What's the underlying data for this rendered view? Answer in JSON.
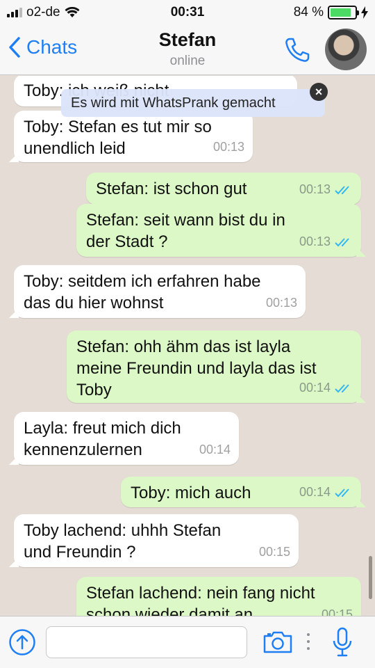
{
  "status_bar": {
    "carrier": "o2-de",
    "time": "00:31",
    "battery_percent": "84 %",
    "battery_level": 0.84,
    "icons": [
      "signal-icon",
      "wifi-icon",
      "battery-icon",
      "charging-icon"
    ]
  },
  "header": {
    "back_label": "Chats",
    "contact_name": "Stefan",
    "contact_status": "online",
    "icons": [
      "chevron-left-icon",
      "phone-icon",
      "avatar"
    ]
  },
  "banner": {
    "text": "Es wird mit WhatsPrank gemacht",
    "close_label": "×"
  },
  "messages": [
    {
      "direction": "in",
      "text": "Toby: ich weiß nicht",
      "time": ""
    },
    {
      "direction": "in",
      "text": "Toby: Stefan es tut mir so\nunendlich leid",
      "time": "00:13"
    },
    {
      "direction": "out",
      "text": "Stefan: ist schon gut",
      "time": "00:13"
    },
    {
      "direction": "out",
      "text": "Stefan: seit wann bist du in\nder Stadt ?",
      "time": "00:13"
    },
    {
      "direction": "in",
      "text": "Toby: seitdem ich erfahren habe\ndas du hier wohnst",
      "time": "00:13"
    },
    {
      "direction": "out",
      "text": "Stefan: ohh ähm das ist layla\nmeine Freundin und layla das ist\nToby",
      "time": "00:14"
    },
    {
      "direction": "in",
      "text": "Layla: freut mich dich\nkennenzulernen",
      "time": "00:14"
    },
    {
      "direction": "out",
      "text": "Toby: mich auch",
      "time": "00:14"
    },
    {
      "direction": "in",
      "text": "Toby lachend: uhhh Stefan\nund Freundin ?",
      "time": "00:15"
    },
    {
      "direction": "out",
      "text": "Stefan lachend: nein fang nicht\nschon wieder damit an",
      "time": "00:15"
    }
  ],
  "input_bar": {
    "placeholder": "",
    "icons": [
      "upload-icon",
      "camera-icon",
      "more-dots-icon",
      "microphone-icon"
    ]
  },
  "colors": {
    "accent": "#1e7ff5",
    "incoming_bubble": "#ffffff",
    "outgoing_bubble": "#dcf8c6",
    "chat_background": "#e5ddd5",
    "read_ticks": "#34b7f1"
  }
}
